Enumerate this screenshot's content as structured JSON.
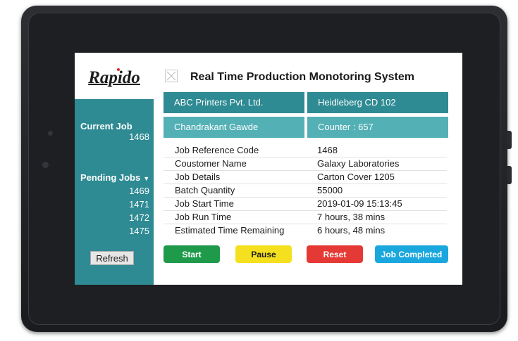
{
  "sidebar": {
    "logo": "Rapido",
    "current_job": {
      "label": "Current Job",
      "value": "1468"
    },
    "pending_jobs": {
      "label": "Pending Jobs",
      "items": [
        "1469",
        "1471",
        "1472",
        "1475"
      ]
    },
    "refresh_label": "Refresh"
  },
  "header": {
    "title": "Real Time Production Monotoring System"
  },
  "tiles": {
    "company": "ABC Printers Pvt. Ltd.",
    "machine": "Heidleberg CD 102",
    "operator": "Chandrakant Gawde",
    "counter": "Counter : 657"
  },
  "details": [
    {
      "label": "Job Reference Code",
      "value": "1468"
    },
    {
      "label": "Coustomer Name",
      "value": "Galaxy Laboratories"
    },
    {
      "label": "Job Details",
      "value": "Carton Cover 1205"
    },
    {
      "label": "Batch Quantity",
      "value": "55000"
    },
    {
      "label": "Job Start Time",
      "value": "2019-01-09 15:13:45"
    },
    {
      "label": "Job Run Time",
      "value": "7 hours, 38 mins"
    },
    {
      "label": "Estimated Time Remaining",
      "value": "6 hours, 48 mins"
    }
  ],
  "actions": {
    "start": "Start",
    "pause": "Pause",
    "reset": "Reset",
    "complete": "Job Completed"
  },
  "colors": {
    "teal_dark": "#2e8a93",
    "teal_light": "#53b0b5",
    "start": "#1e9a4a",
    "pause": "#f5e01f",
    "reset": "#e53935",
    "complete": "#1aa7de"
  }
}
